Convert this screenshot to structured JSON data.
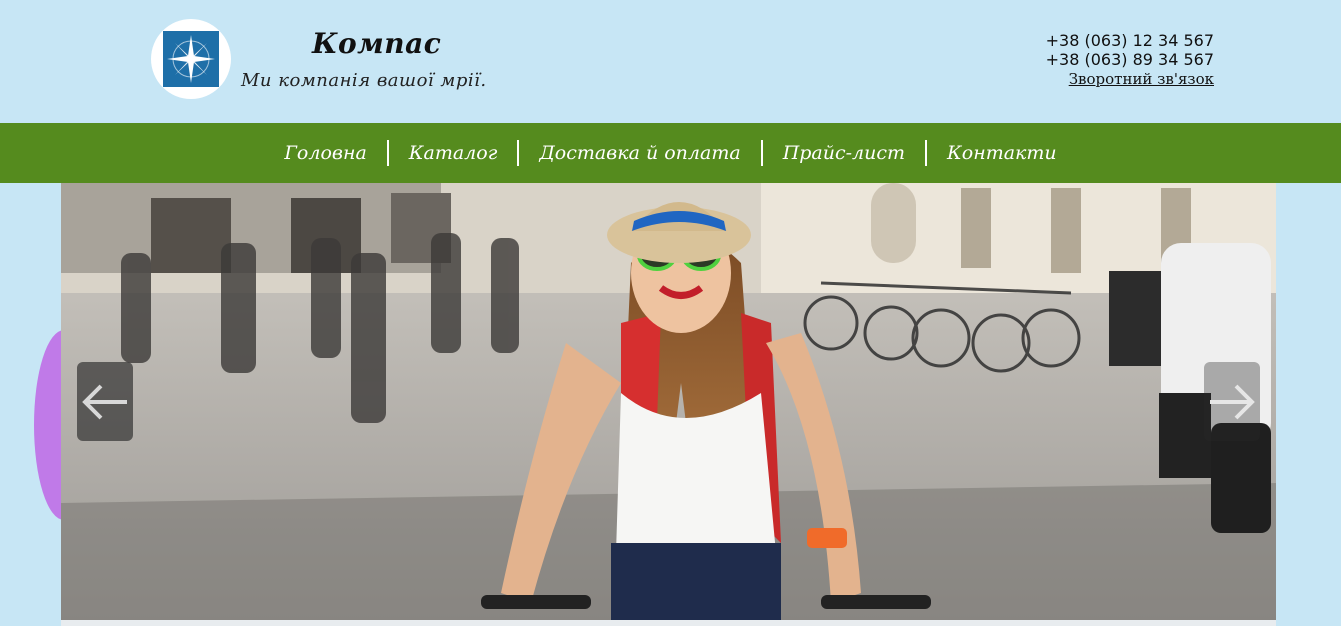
{
  "header": {
    "brand_title": "Компас",
    "tagline": "Ми компанія вашої мрії.",
    "logo_icon": "compass-rose-icon",
    "phones": [
      "+38 (063) 12 34 567",
      "+38 (063) 89 34 567"
    ],
    "feedback_link": "Зворотний зв'язок"
  },
  "nav": {
    "items": [
      {
        "label": "Головна"
      },
      {
        "label": "Каталог"
      },
      {
        "label": "Доставка й оплата"
      },
      {
        "label": "Прайс-лист"
      },
      {
        "label": "Контакти"
      }
    ]
  },
  "slider": {
    "prev_icon": "arrow-left-icon",
    "next_icon": "arrow-right-icon"
  },
  "colors": {
    "page_background": "#c7e6f5",
    "nav_background": "#558b1e",
    "logo_blue": "#1e6fa8",
    "accent_purple": "#c07ae8"
  }
}
